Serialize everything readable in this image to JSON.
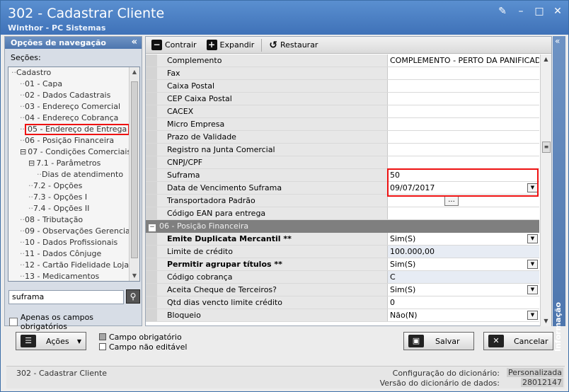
{
  "window": {
    "title": "302 - Cadastrar Cliente",
    "subtitle": "Winthor - PC Sistemas"
  },
  "nav": {
    "header": "Opções de navegação",
    "sections_label": "Seções:",
    "tree": [
      {
        "label": "Cadastro",
        "prefix": "",
        "indent": 0
      },
      {
        "label": "01 - Capa",
        "prefix": "",
        "indent": 1
      },
      {
        "label": "02 - Dados Cadastrais",
        "prefix": "",
        "indent": 1
      },
      {
        "label": "03 - Endereço Comercial",
        "prefix": "",
        "indent": 1
      },
      {
        "label": "04 - Endereço Cobrança",
        "prefix": "",
        "indent": 1
      },
      {
        "label": "05 - Endereço de Entrega",
        "prefix": "",
        "indent": 1,
        "selected": true
      },
      {
        "label": "06 - Posição Financeira",
        "prefix": "",
        "indent": 1
      },
      {
        "label": "07 - Condições Comerciais",
        "prefix": "⊟",
        "indent": 1
      },
      {
        "label": "7.1 - Parâmetros",
        "prefix": "⊟",
        "indent": 2
      },
      {
        "label": "Dias de atendimento",
        "prefix": "",
        "indent": 3
      },
      {
        "label": "7.2 - Opções",
        "prefix": "",
        "indent": 2
      },
      {
        "label": "7.3 - Opções I",
        "prefix": "",
        "indent": 2
      },
      {
        "label": "7.4 - Opções II",
        "prefix": "",
        "indent": 2
      },
      {
        "label": "08 - Tributação",
        "prefix": "",
        "indent": 1
      },
      {
        "label": "09 - Observações Gerenciais",
        "prefix": "",
        "indent": 1
      },
      {
        "label": "10 - Dados Profissionais",
        "prefix": "",
        "indent": 1
      },
      {
        "label": "11 - Dados Cônjuge",
        "prefix": "",
        "indent": 1
      },
      {
        "label": "12 - Cartão Fidelidade Lojas",
        "prefix": "",
        "indent": 1
      },
      {
        "label": "13 - Medicamentos",
        "prefix": "",
        "indent": 1
      }
    ],
    "search_value": "suframa",
    "only_required_label": "Apenas os campos obrigatórios"
  },
  "toolbar": {
    "collapse_label": "Contrair",
    "expand_label": "Expandir",
    "restore_label": "Restaurar"
  },
  "grid": {
    "rows_top": [
      {
        "label": "Complemento",
        "value": "COMPLEMENTO - PERTO DA PANIFICADOR"
      },
      {
        "label": "Fax",
        "value": ""
      },
      {
        "label": "Caixa Postal",
        "value": ""
      },
      {
        "label": "CEP Caixa Postal",
        "value": ""
      },
      {
        "label": "CACEX",
        "value": ""
      },
      {
        "label": "Micro Empresa",
        "value": ""
      },
      {
        "label": "Prazo de Validade",
        "value": ""
      },
      {
        "label": "Registro na Junta Comercial",
        "value": ""
      },
      {
        "label": "CNPJ/CPF",
        "value": ""
      },
      {
        "label": "Suframa",
        "value": "50"
      },
      {
        "label": "Data de Vencimento Suframa",
        "value": "09/07/2017",
        "dropdown": true
      },
      {
        "label": "Transportadora Padrão",
        "value": "",
        "ellipsis": "..."
      },
      {
        "label": "Código EAN para entrega",
        "value": ""
      }
    ],
    "section_title": "06 - Posição Financeira",
    "rows_bottom": [
      {
        "label": "Emite Duplicata Mercantil **",
        "value": "Sim(S)",
        "dropdown": true,
        "bold": true
      },
      {
        "label": "Limite de crédito",
        "value": "100.000,00",
        "blue": true
      },
      {
        "label": "Permitir agrupar títulos **",
        "value": "Sim(S)",
        "dropdown": true,
        "bold": true
      },
      {
        "label": "Código cobrança",
        "value": "C",
        "blue": true
      },
      {
        "label": "Aceita Cheque de Terceiros?",
        "value": "Sim(S)",
        "dropdown": true
      },
      {
        "label": "Qtd dias vencto limite crédito",
        "value": "0"
      },
      {
        "label": "Bloqueio",
        "value": "Não(N)",
        "dropdown": true
      }
    ]
  },
  "side_panel": {
    "label": "Informação"
  },
  "bottom": {
    "actions_label": "Ações",
    "legend_required": "Campo obrigatório",
    "legend_not_editable": "Campo não editável",
    "save_label": "Salvar",
    "cancel_label": "Cancelar"
  },
  "status": {
    "left": "302 - Cadastrar Cliente",
    "dict_config_label": "Configuração do dicionário:",
    "dict_config_value": "Personalizada",
    "dict_version_label": "Versão do dicionário de dados:",
    "dict_version_value": "28012147"
  },
  "colors": {
    "titlebar": "#4a7fc3",
    "highlight": "#e11111",
    "required_square": "#a6a6a6",
    "not_editable_square": "#ffffff"
  }
}
